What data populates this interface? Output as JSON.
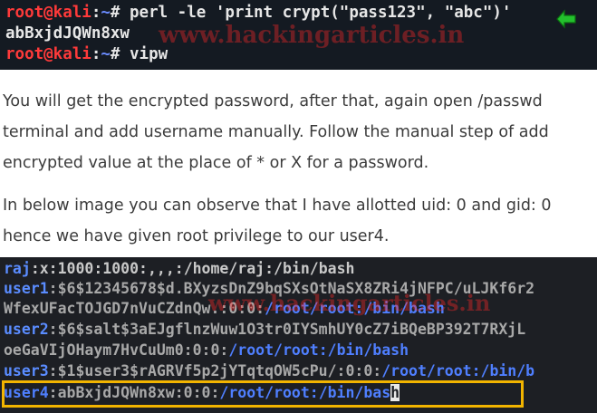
{
  "watermark": "www.hackingarticles.in",
  "terminal1": {
    "prompt_user_host": "root@kali",
    "prompt_sep": ":",
    "prompt_path": "~",
    "prompt_symbol": "#",
    "cmd1": " perl -le 'print crypt(\"pass123\", \"abc\")'",
    "output1": "abBxjdJQWn8xw",
    "cmd2": " vipw"
  },
  "article": {
    "para1": [
      "You will get the encrypted password, after that, again open /passwd",
      "terminal and add username manually. Follow the manual step of add",
      "encrypted value at the place of * or X for a password."
    ],
    "para2": [
      "In below image you can observe that I have allotted uid: 0 and gid: 0",
      "hence we have given root privilege to our user4."
    ]
  },
  "terminal2": {
    "line1": {
      "name": "raj",
      "rest": ":x:1000:1000:,,,:/home/raj:/bin/bash"
    },
    "line2": {
      "name": "user1",
      "rest": ":$6$12345678$d.BXyzsDnZ9bqSXsOtNaSX8ZRi4jNFPC/uLJKf6r2"
    },
    "line3": {
      "rest_a": "WfexUFacTOJGD7nVuCZdnQw.:0:0:",
      "rest_b": "/root/root:/bin/bash"
    },
    "line4": {
      "name": "user2",
      "rest": ":$6$salt$3aEJgflnzWuw1O3tr0IYSmhUY0cZ7iBQeBP392T7RXjL"
    },
    "line5": {
      "rest_a": "oeGaVIjOHaym7HvCuUm0:0:0:",
      "rest_b": "/root/root:/bin/bash"
    },
    "line6": {
      "name": "user3",
      "rest_a": ":$1$user3$rAGRVf5p2jYTqtqOW5cPu/:0:0:",
      "rest_b": "/root/root:/bin/b"
    },
    "line7": {
      "name": "user4",
      "rest_a": ":abBxjdJQWn8xw:0:0:",
      "rest_b": "/root/root:/bin/bas",
      "cursor_char": "h"
    }
  }
}
